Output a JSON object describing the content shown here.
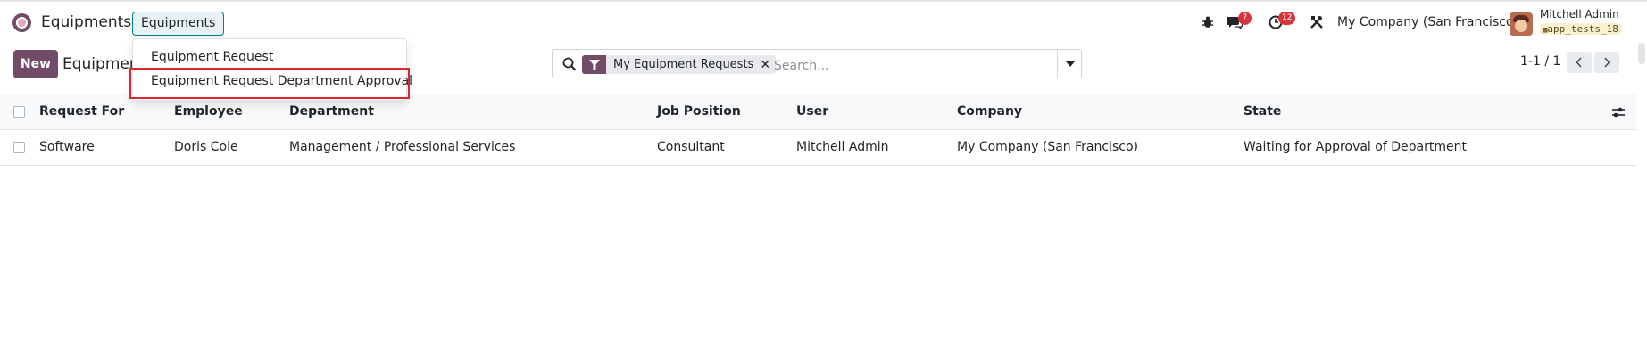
{
  "navbar": {
    "app_name": "Equipments",
    "menu_label": "Equipments",
    "bug_icon": "bug-icon",
    "chat_icon": "chat-icon",
    "chat_count": "7",
    "activity_icon": "clock-icon",
    "activity_count": "12",
    "tools_icon": "tools-icon",
    "company": "My Company (San Francisco)",
    "user_name": "Mitchell Admin",
    "database": "app_tests_18"
  },
  "dropdown": {
    "items": [
      {
        "label": "Equipment Request"
      },
      {
        "label": "Equipment Request Department Approval"
      }
    ]
  },
  "control": {
    "new_label": "New",
    "breadcrumb": "Equipment Requests",
    "search": {
      "facet_label": "My Equipment Requests",
      "placeholder": "Search..."
    },
    "pager": "1-1 / 1"
  },
  "table": {
    "columns": [
      "Request For",
      "Employee",
      "Department",
      "Job Position",
      "User",
      "Company",
      "State"
    ],
    "rows": [
      {
        "request_for": "Software",
        "employee": "Doris Cole",
        "department": "Management / Professional Services",
        "job_position": "Consultant",
        "user": "Mitchell Admin",
        "company": "My Company (San Francisco)",
        "state": "Waiting for Approval of Department"
      }
    ]
  },
  "colors": {
    "brand": "#714b67",
    "accent": "#017e84",
    "badge": "#d9343b",
    "highlight": "#d9272e"
  }
}
